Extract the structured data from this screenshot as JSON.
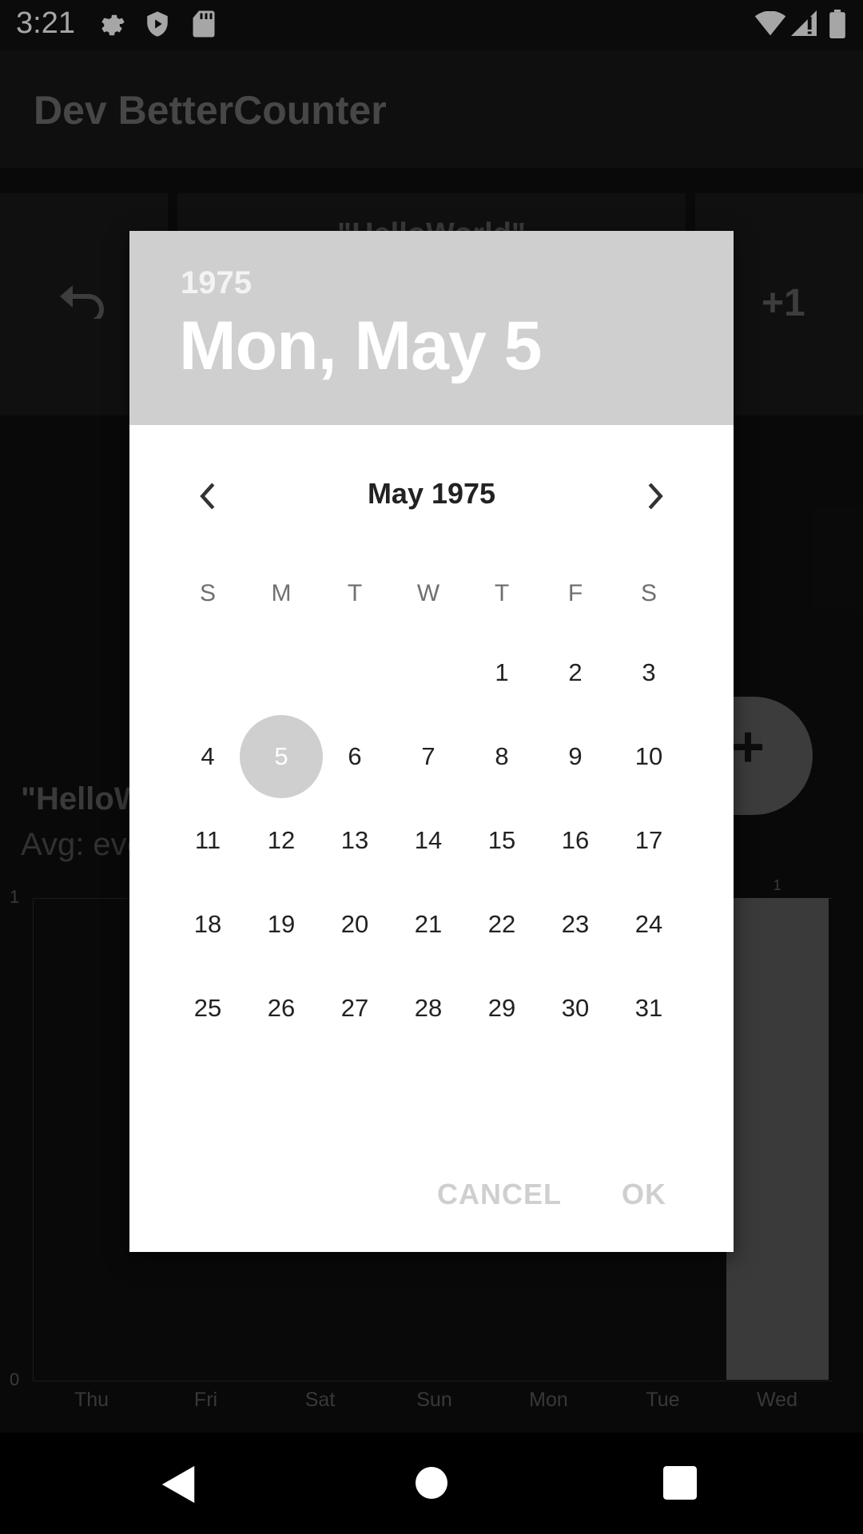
{
  "status": {
    "time": "3:21"
  },
  "app": {
    "title": "Dev BetterCounter"
  },
  "counter_card": {
    "title": "\"HelloWorld\"",
    "increment_label": "+1"
  },
  "stats": {
    "title": "\"HelloW",
    "avg": "Avg: eve"
  },
  "chart_data": {
    "type": "bar",
    "categories": [
      "Thu",
      "Fri",
      "Sat",
      "Sun",
      "Mon",
      "Tue",
      "Wed"
    ],
    "values": [
      0,
      0,
      0,
      0,
      0,
      0,
      1
    ],
    "ylim": [
      0,
      1
    ],
    "ytick_labels": [
      "1",
      "0"
    ],
    "data_labels": [
      "",
      "",
      "",
      "",
      "",
      "",
      "1"
    ],
    "title": "",
    "xlabel": "",
    "ylabel": ""
  },
  "dialog": {
    "year": "1975",
    "selected_date": "Mon, May 5",
    "month_label": "May 1975",
    "weekdays": [
      "S",
      "M",
      "T",
      "W",
      "T",
      "F",
      "S"
    ],
    "cancel_label": "CANCEL",
    "ok_label": "OK",
    "selected_day": 5,
    "first_weekday_index": 4,
    "days_in_month": 31
  },
  "colors": {
    "accent": "#cfcfcf",
    "dialog_bg": "#ffffff",
    "scrim": "#000000"
  }
}
